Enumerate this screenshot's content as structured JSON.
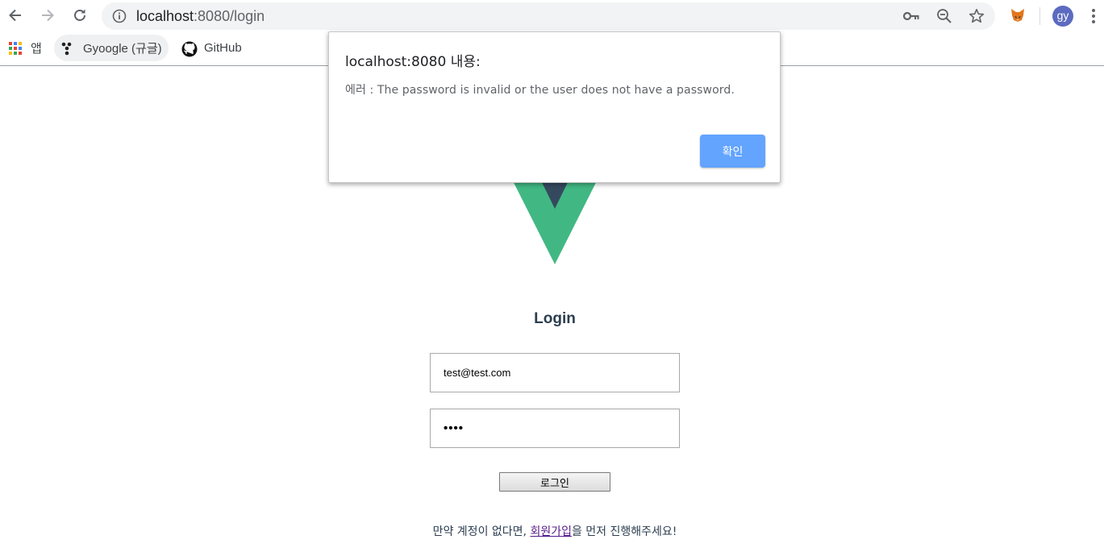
{
  "browser": {
    "url_host": "localhost",
    "url_path": ":8080/login",
    "avatar_initials": "gy",
    "icons": [
      "back-icon",
      "forward-icon",
      "reload-icon",
      "info-icon",
      "key-icon",
      "zoom-icon",
      "star-icon",
      "metamask-fox-icon",
      "more-vert-icon"
    ]
  },
  "bookmarks": {
    "apps_label": "앱",
    "items": [
      {
        "label": "Gyoogle (규글)",
        "icon": "gyoogle-icon"
      },
      {
        "label": "GitHub",
        "icon": "github-icon"
      }
    ]
  },
  "page": {
    "title": "Login",
    "email_value": "test@test.com",
    "password_masked": "••••",
    "login_button": "로그인",
    "signup_prefix": "만약 계정이 없다면, ",
    "signup_link": "회원가입",
    "signup_suffix": "을 먼저 진행해주세요!",
    "logo": "vue-logo",
    "colors": {
      "vue_green": "#41b883",
      "vue_dark": "#35495e"
    }
  },
  "dialog": {
    "title": "localhost:8080 내용:",
    "message": "에러 : The password is invalid or the user does not have a password.",
    "ok_button": "확인",
    "ok_color": "#63a4ff"
  }
}
